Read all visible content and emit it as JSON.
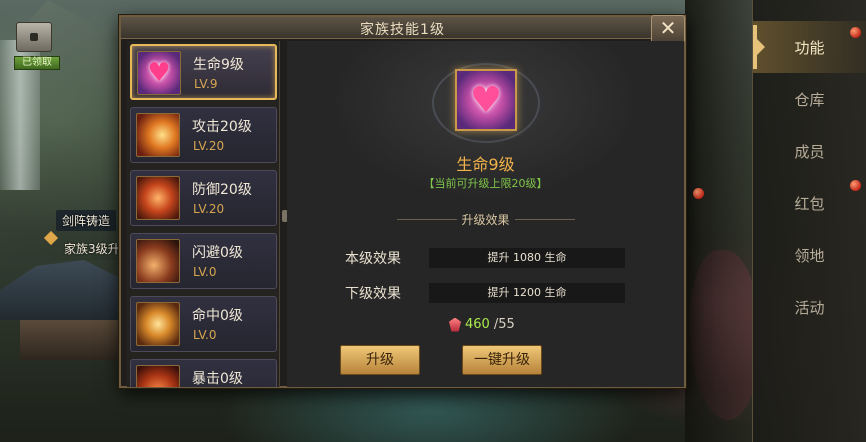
{
  "hud": {
    "claimed_label": "已领取",
    "side_label_1": "剑阵铸造",
    "side_label_2": "家族3级升"
  },
  "right_menu": {
    "items": [
      {
        "label": "功能",
        "active": true
      },
      {
        "label": "仓库"
      },
      {
        "label": "成员"
      },
      {
        "label": "红包"
      },
      {
        "label": "领地"
      },
      {
        "label": "活动"
      }
    ]
  },
  "dialog": {
    "title": "家族技能1级",
    "close_label": "✕",
    "skills": [
      {
        "name": "生命9级",
        "level": "LV.9",
        "icon": "heart-icon"
      },
      {
        "name": "攻击20级",
        "level": "LV.20",
        "icon": "sword-icon"
      },
      {
        "name": "防御20级",
        "level": "LV.20",
        "icon": "shield-icon"
      },
      {
        "name": "闪避0级",
        "level": "LV.0",
        "icon": "dodge-icon"
      },
      {
        "name": "命中0级",
        "level": "LV.0",
        "icon": "target-icon"
      },
      {
        "name": "暴击0级",
        "level": "",
        "icon": "crit-icon"
      }
    ],
    "detail": {
      "name": "生命9级",
      "cap_note": "【当前可升级上限20级】",
      "section_title": "升级效果",
      "current_label": "本级效果",
      "current_value": "提升 1080 生命",
      "next_label": "下级效果",
      "next_value": "提升 1200 生命",
      "cost_have": "460",
      "cost_need": "/55",
      "upgrade_label": "升级",
      "oneclick_label": "一键升级"
    }
  },
  "colors": {
    "accent_gold": "#e7b95a",
    "level_text": "#d6a64f",
    "cap_green": "#7fc64a",
    "skill_name": "#f2b24a"
  }
}
